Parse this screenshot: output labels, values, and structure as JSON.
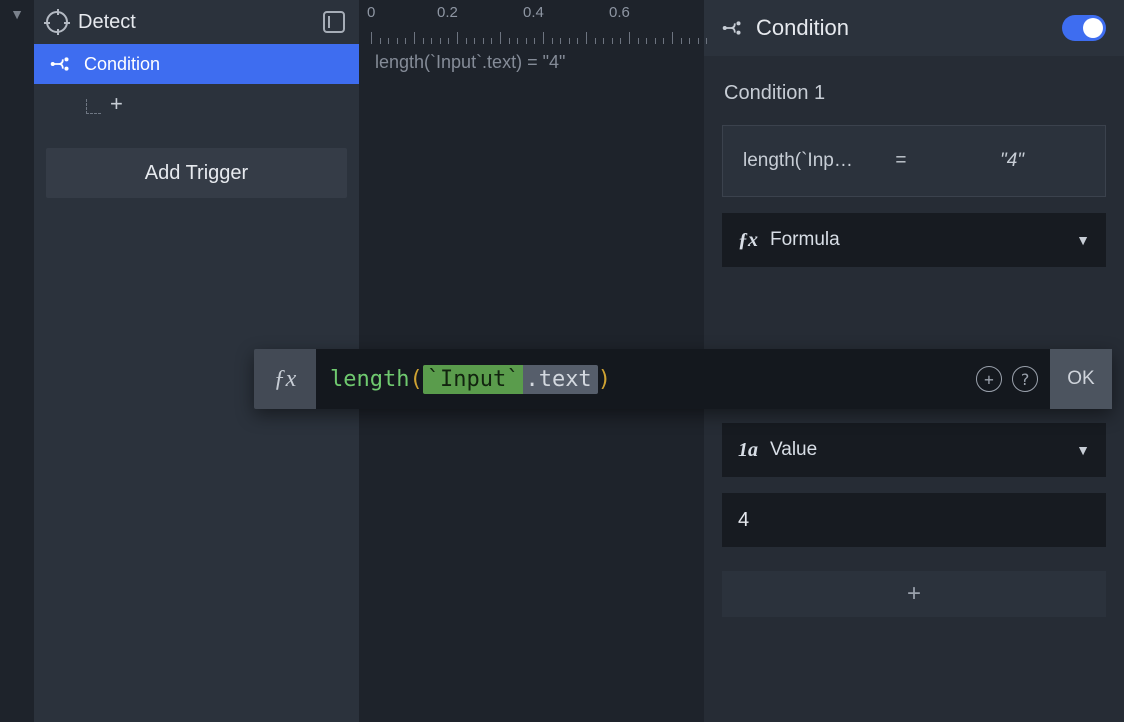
{
  "gutter": {
    "collapse_glyph": "▼"
  },
  "left_panel": {
    "header_title": "Detect",
    "tree": {
      "items": [
        {
          "label": "Condition",
          "selected": true
        }
      ],
      "add_glyph": "+"
    },
    "add_trigger_label": "Add Trigger"
  },
  "canvas": {
    "ruler_labels": [
      "0",
      "0.2",
      "0.4",
      "0.6"
    ],
    "expression_text": "length(`Input`.text) = \"4\""
  },
  "inspector": {
    "header_title": "Condition",
    "toggle_on": true,
    "section_label": "Condition 1",
    "summary": {
      "lhs": "length(`Inp…",
      "op": "=",
      "rhs": "\"4\""
    },
    "formula_selector": {
      "icon_text": "ƒx",
      "label": "Formula"
    },
    "operators": [
      {
        "glyph": ">",
        "active": false
      },
      {
        "glyph": "≥",
        "active": false
      },
      {
        "glyph": "<",
        "active": false
      },
      {
        "glyph": "≤",
        "active": false
      },
      {
        "glyph": "=",
        "active": true
      },
      {
        "glyph": "≠",
        "active": false
      }
    ],
    "value_selector": {
      "icon_text": "1a",
      "label": "Value"
    },
    "value_input": "4",
    "add_condition_glyph": "+"
  },
  "formula_editor": {
    "fx_glyph": "ƒx",
    "fn": "length",
    "open": "(",
    "ref": "`Input`",
    "prop": ".text",
    "close": ")",
    "plus_glyph": "+",
    "help_glyph": "?",
    "ok_label": "OK"
  }
}
